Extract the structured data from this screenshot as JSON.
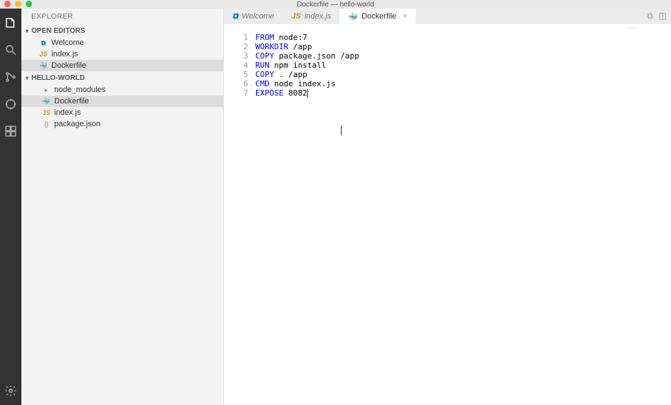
{
  "window": {
    "title": "Dockerfile — hello-world"
  },
  "activity_bar": {
    "items": [
      "files",
      "search",
      "scm",
      "debug",
      "extensions"
    ],
    "bottom": "settings"
  },
  "sidebar": {
    "title": "EXPLORER",
    "sections": [
      {
        "label": "OPEN EDITORS",
        "items": [
          {
            "icon": "vs",
            "iconText": "⧉",
            "label": "Welcome",
            "active": false
          },
          {
            "icon": "js",
            "iconText": "JS",
            "label": "index.js",
            "active": false
          },
          {
            "icon": "docker",
            "iconText": "🐳",
            "label": "Dockerfile",
            "active": true
          }
        ]
      },
      {
        "label": "HELLO-WORLD",
        "items": [
          {
            "icon": "folder",
            "iconText": "▸",
            "label": "node_modules",
            "active": false,
            "indent": 1
          },
          {
            "icon": "docker",
            "iconText": "🐳",
            "label": "Dockerfile",
            "active": true,
            "indent": 1
          },
          {
            "icon": "js",
            "iconText": "JS",
            "label": "index.js",
            "active": false,
            "indent": 1
          },
          {
            "icon": "json",
            "iconText": "{}",
            "label": "package.json",
            "active": false,
            "indent": 1
          }
        ]
      }
    ]
  },
  "tabs": [
    {
      "icon": "vs",
      "iconText": "⧉",
      "label": "Welcome",
      "active": false,
      "close": ""
    },
    {
      "icon": "js",
      "iconText": "JS",
      "label": "index.js",
      "active": false,
      "close": ""
    },
    {
      "icon": "docker",
      "iconText": "🐳",
      "label": "Dockerfile",
      "active": true,
      "close": "×"
    }
  ],
  "editor": {
    "lines": [
      {
        "n": "1",
        "kw": "FROM",
        "rest": " node:7"
      },
      {
        "n": "2",
        "kw": "WORKDIR",
        "rest": " /app"
      },
      {
        "n": "3",
        "kw": "COPY",
        "rest": " package.json /app"
      },
      {
        "n": "4",
        "kw": "RUN",
        "rest": " npm install"
      },
      {
        "n": "5",
        "kw": "COPY",
        "rest": " . /app"
      },
      {
        "n": "6",
        "kw": "CMD",
        "rest": " node index.js"
      },
      {
        "n": "7",
        "kw": "EXPOSE",
        "rest": " 8082"
      }
    ]
  },
  "breadcrumb_icon": "⋯"
}
